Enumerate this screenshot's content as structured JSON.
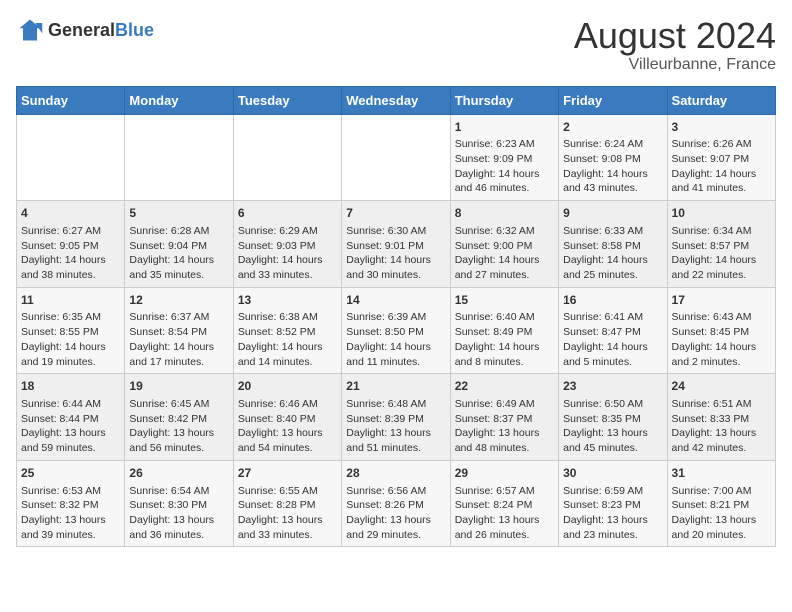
{
  "header": {
    "logo_general": "General",
    "logo_blue": "Blue",
    "main_title": "August 2024",
    "subtitle": "Villeurbanne, France"
  },
  "calendar": {
    "weekdays": [
      "Sunday",
      "Monday",
      "Tuesday",
      "Wednesday",
      "Thursday",
      "Friday",
      "Saturday"
    ],
    "weeks": [
      [
        {
          "day": "",
          "content": ""
        },
        {
          "day": "",
          "content": ""
        },
        {
          "day": "",
          "content": ""
        },
        {
          "day": "",
          "content": ""
        },
        {
          "day": "1",
          "content": "Sunrise: 6:23 AM\nSunset: 9:09 PM\nDaylight: 14 hours and 46 minutes."
        },
        {
          "day": "2",
          "content": "Sunrise: 6:24 AM\nSunset: 9:08 PM\nDaylight: 14 hours and 43 minutes."
        },
        {
          "day": "3",
          "content": "Sunrise: 6:26 AM\nSunset: 9:07 PM\nDaylight: 14 hours and 41 minutes."
        }
      ],
      [
        {
          "day": "4",
          "content": "Sunrise: 6:27 AM\nSunset: 9:05 PM\nDaylight: 14 hours and 38 minutes."
        },
        {
          "day": "5",
          "content": "Sunrise: 6:28 AM\nSunset: 9:04 PM\nDaylight: 14 hours and 35 minutes."
        },
        {
          "day": "6",
          "content": "Sunrise: 6:29 AM\nSunset: 9:03 PM\nDaylight: 14 hours and 33 minutes."
        },
        {
          "day": "7",
          "content": "Sunrise: 6:30 AM\nSunset: 9:01 PM\nDaylight: 14 hours and 30 minutes."
        },
        {
          "day": "8",
          "content": "Sunrise: 6:32 AM\nSunset: 9:00 PM\nDaylight: 14 hours and 27 minutes."
        },
        {
          "day": "9",
          "content": "Sunrise: 6:33 AM\nSunset: 8:58 PM\nDaylight: 14 hours and 25 minutes."
        },
        {
          "day": "10",
          "content": "Sunrise: 6:34 AM\nSunset: 8:57 PM\nDaylight: 14 hours and 22 minutes."
        }
      ],
      [
        {
          "day": "11",
          "content": "Sunrise: 6:35 AM\nSunset: 8:55 PM\nDaylight: 14 hours and 19 minutes."
        },
        {
          "day": "12",
          "content": "Sunrise: 6:37 AM\nSunset: 8:54 PM\nDaylight: 14 hours and 17 minutes."
        },
        {
          "day": "13",
          "content": "Sunrise: 6:38 AM\nSunset: 8:52 PM\nDaylight: 14 hours and 14 minutes."
        },
        {
          "day": "14",
          "content": "Sunrise: 6:39 AM\nSunset: 8:50 PM\nDaylight: 14 hours and 11 minutes."
        },
        {
          "day": "15",
          "content": "Sunrise: 6:40 AM\nSunset: 8:49 PM\nDaylight: 14 hours and 8 minutes."
        },
        {
          "day": "16",
          "content": "Sunrise: 6:41 AM\nSunset: 8:47 PM\nDaylight: 14 hours and 5 minutes."
        },
        {
          "day": "17",
          "content": "Sunrise: 6:43 AM\nSunset: 8:45 PM\nDaylight: 14 hours and 2 minutes."
        }
      ],
      [
        {
          "day": "18",
          "content": "Sunrise: 6:44 AM\nSunset: 8:44 PM\nDaylight: 13 hours and 59 minutes."
        },
        {
          "day": "19",
          "content": "Sunrise: 6:45 AM\nSunset: 8:42 PM\nDaylight: 13 hours and 56 minutes."
        },
        {
          "day": "20",
          "content": "Sunrise: 6:46 AM\nSunset: 8:40 PM\nDaylight: 13 hours and 54 minutes."
        },
        {
          "day": "21",
          "content": "Sunrise: 6:48 AM\nSunset: 8:39 PM\nDaylight: 13 hours and 51 minutes."
        },
        {
          "day": "22",
          "content": "Sunrise: 6:49 AM\nSunset: 8:37 PM\nDaylight: 13 hours and 48 minutes."
        },
        {
          "day": "23",
          "content": "Sunrise: 6:50 AM\nSunset: 8:35 PM\nDaylight: 13 hours and 45 minutes."
        },
        {
          "day": "24",
          "content": "Sunrise: 6:51 AM\nSunset: 8:33 PM\nDaylight: 13 hours and 42 minutes."
        }
      ],
      [
        {
          "day": "25",
          "content": "Sunrise: 6:53 AM\nSunset: 8:32 PM\nDaylight: 13 hours and 39 minutes."
        },
        {
          "day": "26",
          "content": "Sunrise: 6:54 AM\nSunset: 8:30 PM\nDaylight: 13 hours and 36 minutes."
        },
        {
          "day": "27",
          "content": "Sunrise: 6:55 AM\nSunset: 8:28 PM\nDaylight: 13 hours and 33 minutes."
        },
        {
          "day": "28",
          "content": "Sunrise: 6:56 AM\nSunset: 8:26 PM\nDaylight: 13 hours and 29 minutes."
        },
        {
          "day": "29",
          "content": "Sunrise: 6:57 AM\nSunset: 8:24 PM\nDaylight: 13 hours and 26 minutes."
        },
        {
          "day": "30",
          "content": "Sunrise: 6:59 AM\nSunset: 8:23 PM\nDaylight: 13 hours and 23 minutes."
        },
        {
          "day": "31",
          "content": "Sunrise: 7:00 AM\nSunset: 8:21 PM\nDaylight: 13 hours and 20 minutes."
        }
      ]
    ]
  }
}
